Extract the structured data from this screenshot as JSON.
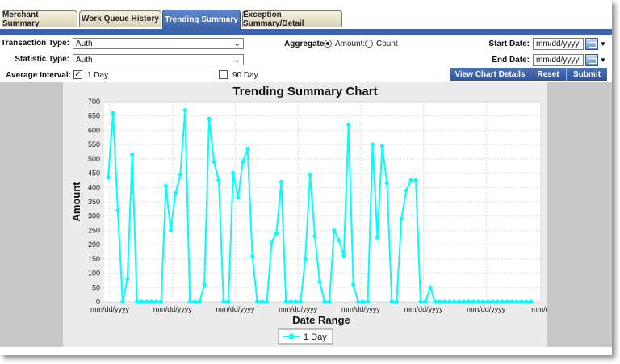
{
  "tabs": [
    {
      "label": "Merchant Summary",
      "active": false
    },
    {
      "label": "Work Queue History",
      "active": false
    },
    {
      "label": "Trending Summary",
      "active": true
    },
    {
      "label": "Exception Summary/Detail",
      "active": false
    }
  ],
  "form": {
    "transaction_type_label": "Transaction Type:",
    "transaction_type_value": "Auth",
    "statistic_type_label": "Statistic Type:",
    "statistic_type_value": "Auth",
    "average_interval_label": "Average Interval:",
    "one_day_label": "1 Day",
    "one_day_checked": true,
    "ninety_day_label": "90 Day",
    "ninety_day_checked": false,
    "aggregate_label": "Aggregate:",
    "amount_label": "Amount:",
    "count_label": "Count",
    "aggregate_selected": "Amount",
    "start_date_label": "Start Date:",
    "start_date_value": "mm/dd/yyyy",
    "end_date_label": "End Date:",
    "end_date_value": "mm/dd/yyyy"
  },
  "buttons": {
    "view_details": "View Chart Details",
    "reset": "Reset",
    "submit": "Submit"
  },
  "colors": {
    "accent": "#3b64ad",
    "series": "#00ffff"
  },
  "chart_data": {
    "type": "line",
    "title": "Trending Summary Chart",
    "xlabel": "Date Range",
    "ylabel": "Amount",
    "ylim": [
      0,
      700
    ],
    "yticks": [
      0,
      50,
      100,
      150,
      200,
      250,
      300,
      350,
      400,
      450,
      500,
      550,
      600,
      650,
      700
    ],
    "x_tick_labels": [
      "mm/dd/yyyy",
      "mm/dd/yyyy",
      "mm/dd/yyyy",
      "mm/dd/yyyy",
      "mm/dd/yyyy",
      "mm/dd/yyyy",
      "mm/dd/yyyy",
      "mm/dd/yyy"
    ],
    "grid": true,
    "legend": "bottom-center",
    "series": [
      {
        "name": "1 Day",
        "values": [
          435,
          660,
          320,
          0,
          80,
          515,
          0,
          0,
          0,
          0,
          0,
          0,
          405,
          250,
          380,
          445,
          670,
          0,
          0,
          0,
          60,
          640,
          490,
          425,
          0,
          0,
          450,
          365,
          490,
          535,
          160,
          0,
          0,
          0,
          210,
          240,
          420,
          0,
          0,
          0,
          0,
          150,
          445,
          230,
          70,
          0,
          0,
          250,
          215,
          160,
          620,
          60,
          0,
          0,
          0,
          550,
          225,
          545,
          415,
          0,
          0,
          290,
          390,
          425,
          425,
          0,
          0,
          50,
          0,
          0,
          0,
          0,
          0,
          0,
          0,
          0,
          0,
          0,
          0,
          0,
          0,
          0,
          0,
          0,
          0,
          0,
          0,
          0,
          0
        ]
      }
    ]
  }
}
